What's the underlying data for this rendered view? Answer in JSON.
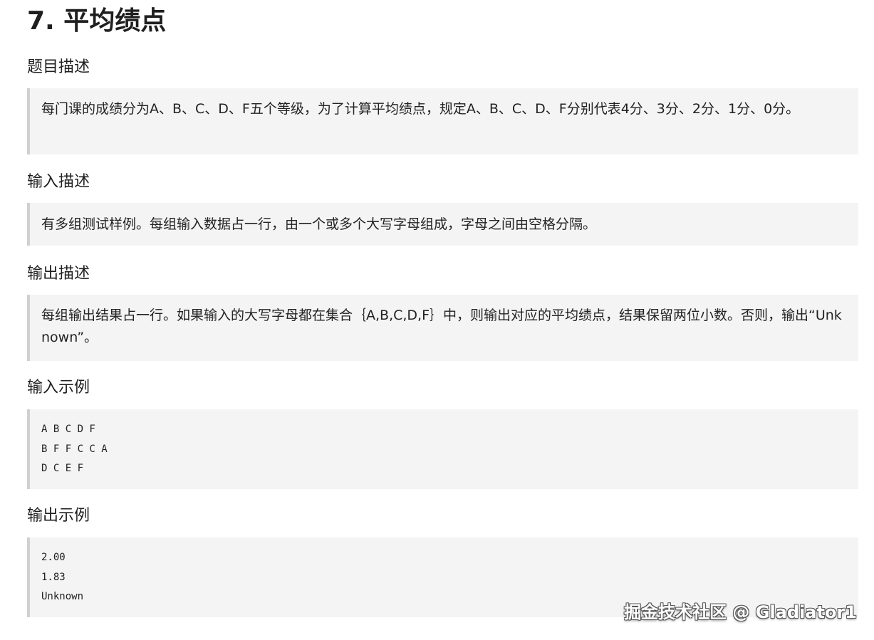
{
  "title": "7. 平均绩点",
  "sections": [
    {
      "heading": "题目描述",
      "text": "每门课的成绩分为A、B、C、D、F五个等级，为了计算平均绩点，规定A、B、C、D、F分别代表4分、3分、2分、1分、0分。"
    },
    {
      "heading": "输入描述",
      "text": "有多组测试样例。每组输入数据占一行，由一个或多个大写字母组成，字母之间由空格分隔。"
    },
    {
      "heading": "输出描述",
      "text": "每组输出结果占一行。如果输入的大写字母都在集合｛A,B,C,D,F｝中，则输出对应的平均绩点，结果保留两位小数。否则，输出“Unknown”。"
    }
  ],
  "input_example": {
    "heading": "输入示例",
    "lines": [
      "A B C D F",
      "B F F C C A",
      "D C E F"
    ]
  },
  "output_example": {
    "heading": "输出示例",
    "lines": [
      "2.00",
      "1.83",
      "Unknown"
    ]
  },
  "watermark": "掘金技术社区 @ Gladiator1"
}
